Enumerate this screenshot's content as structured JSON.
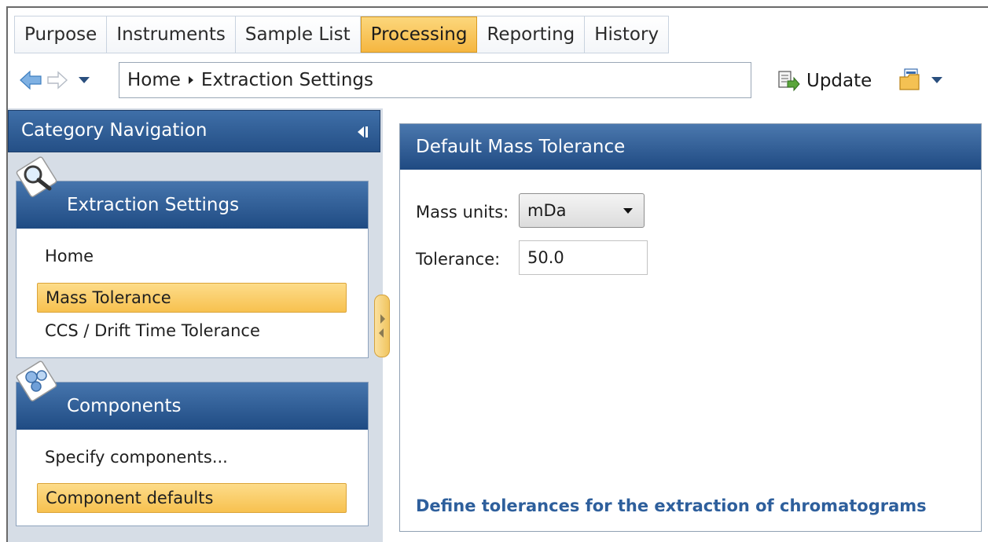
{
  "tabs": [
    {
      "label": "Purpose"
    },
    {
      "label": "Instruments"
    },
    {
      "label": "Sample List"
    },
    {
      "label": "Processing"
    },
    {
      "label": "Reporting"
    },
    {
      "label": "History"
    }
  ],
  "active_tab": "Processing",
  "breadcrumb": {
    "root": "Home",
    "current": "Extraction Settings"
  },
  "toolbar": {
    "update_label": "Update"
  },
  "category_nav": {
    "title": "Category Navigation"
  },
  "groups": [
    {
      "title": "Extraction Settings",
      "icon": "magnifier-icon",
      "items": [
        {
          "label": "Home",
          "selected": false
        },
        {
          "label": "Mass Tolerance",
          "selected": true
        },
        {
          "label": "CCS / Drift Time Tolerance",
          "selected": false
        }
      ]
    },
    {
      "title": "Components",
      "icon": "molecule-icon",
      "items": [
        {
          "label": "Specify components...",
          "selected": false
        },
        {
          "label": "Component defaults",
          "selected": true
        }
      ]
    }
  ],
  "panel": {
    "title": "Default Mass Tolerance",
    "mass_units_label": "Mass units:",
    "mass_units_value": "mDa",
    "tolerance_label": "Tolerance:",
    "tolerance_value": "50.0",
    "footer": "Define tolerances for the extraction of chromatograms"
  },
  "colors": {
    "header_blue": "#244f86",
    "selection_gold": "#f7c14f",
    "link_blue": "#2e5f9c"
  }
}
